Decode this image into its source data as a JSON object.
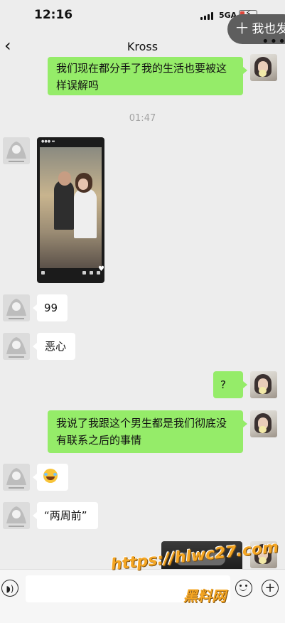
{
  "status_bar": {
    "time": "12:16",
    "network": "5GA",
    "battery_color": "#e0463a"
  },
  "floating_pill": {
    "label": "十 我也发"
  },
  "header": {
    "back_icon": "chevron-left-icon",
    "title": "Kross",
    "more_icon": "more-dots-icon"
  },
  "messages": [
    {
      "side": "right",
      "type": "text",
      "text": "我们现在都分手了我的生活也要被这样误解吗"
    },
    {
      "type": "timestamp",
      "text": "01:47"
    },
    {
      "side": "left",
      "type": "video"
    },
    {
      "side": "left",
      "type": "text",
      "text": "99"
    },
    {
      "side": "left",
      "type": "text",
      "text": "恶心"
    },
    {
      "side": "right",
      "type": "text",
      "text": "?"
    },
    {
      "side": "right",
      "type": "text",
      "text": "我说了我跟这个男生都是我们彻底没有联系之后的事情"
    },
    {
      "side": "left",
      "type": "emoji",
      "icon": "laughing-crying-emoji-icon"
    },
    {
      "side": "left",
      "type": "text",
      "text": "“两周前”"
    },
    {
      "side": "right",
      "type": "image"
    }
  ],
  "message_lines": {
    "m1_line1": "我们现在都分手了我的生活也要被这",
    "m1_line2": "样误解吗",
    "m7_line1": "我说了我跟这个男生都是我们彻底没",
    "m7_line2": "有联系之后的事情"
  },
  "input_bar": {
    "voice_icon": "voice-icon",
    "emoji_icon": "emoji-icon",
    "plus_icon": "plus-icon"
  },
  "watermark": {
    "url": "https://hlwc27.com",
    "name": "黑料网"
  },
  "colors": {
    "bubble_self": "#95ec69",
    "bubble_other": "#ffffff",
    "background": "#ededed",
    "watermark": "#f5a623"
  }
}
